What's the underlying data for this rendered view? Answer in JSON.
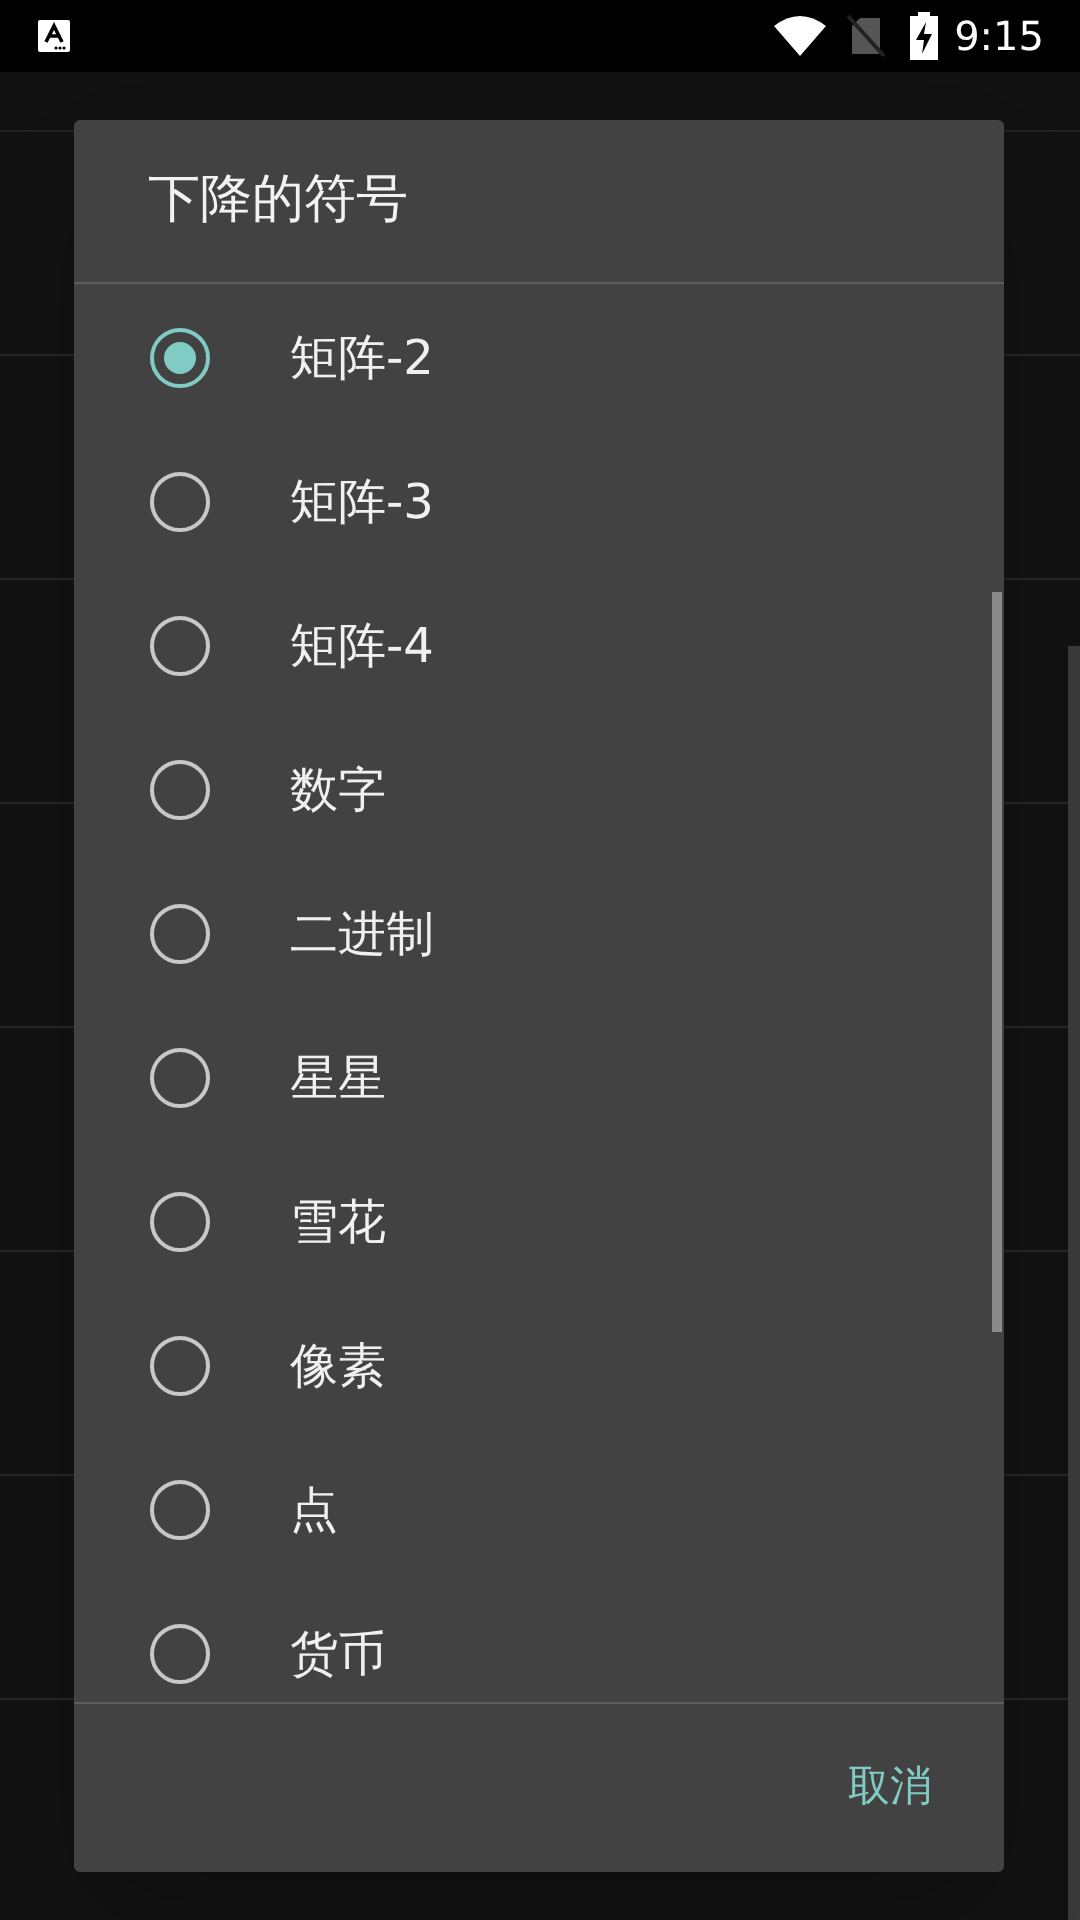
{
  "status_bar": {
    "time": "9:15"
  },
  "dialog": {
    "title": "下降的符号",
    "options": [
      {
        "label": "矩阵-2",
        "selected": true
      },
      {
        "label": "矩阵-3",
        "selected": false
      },
      {
        "label": "矩阵-4",
        "selected": false
      },
      {
        "label": "数字",
        "selected": false
      },
      {
        "label": "二进制",
        "selected": false
      },
      {
        "label": "星星",
        "selected": false
      },
      {
        "label": "雪花",
        "selected": false
      },
      {
        "label": "像素",
        "selected": false
      },
      {
        "label": "点",
        "selected": false
      },
      {
        "label": "货币",
        "selected": false
      }
    ],
    "buttons": [
      {
        "label": "取消"
      }
    ]
  }
}
